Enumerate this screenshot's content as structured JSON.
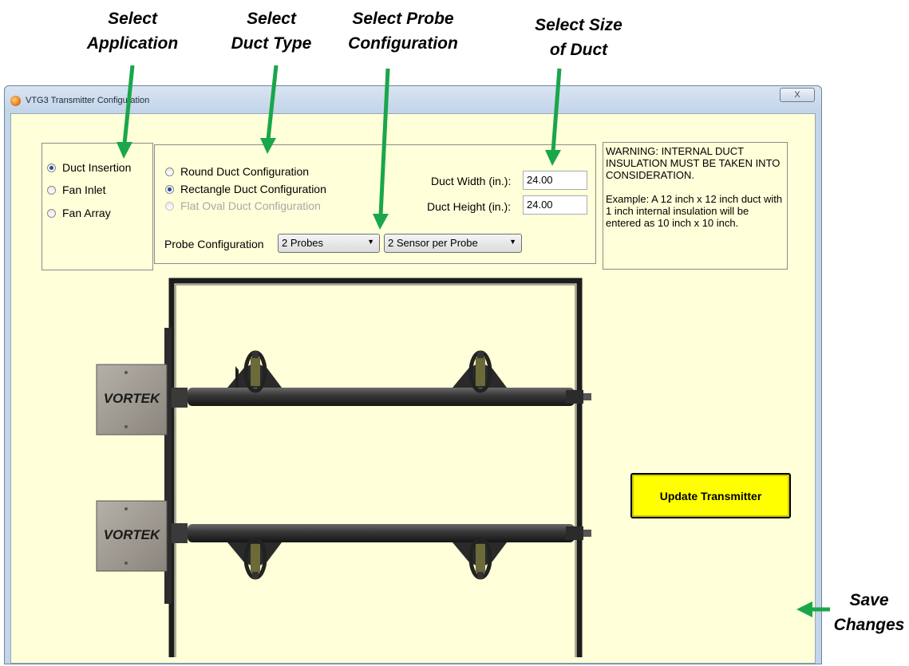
{
  "callouts": {
    "select_application": [
      "Select",
      "Application"
    ],
    "select_duct_type": [
      "Select",
      "Duct Type"
    ],
    "select_probe_configuration": [
      "Select Probe",
      "Configuration"
    ],
    "select_size_of_duct": [
      "Select Size",
      "of Duct"
    ],
    "save_changes": [
      "Save",
      "Changes"
    ]
  },
  "window": {
    "title": "VTG3 Transmitter Configuration",
    "close_label": "X"
  },
  "application": {
    "options": [
      {
        "label": "Duct Insertion",
        "checked": true
      },
      {
        "label": "Fan Inlet",
        "checked": false
      },
      {
        "label": "Fan Array",
        "checked": false
      }
    ]
  },
  "duct_type": {
    "options": [
      {
        "label": "Round Duct Configuration",
        "checked": false,
        "enabled": true
      },
      {
        "label": "Rectangle Duct Configuration",
        "checked": true,
        "enabled": true
      },
      {
        "label": "Flat Oval Duct Configuration",
        "checked": false,
        "enabled": false
      }
    ]
  },
  "duct_size": {
    "width_label": "Duct Width (in.):",
    "width_value": "24.00",
    "height_label": "Duct Height (in.):",
    "height_value": "24.00"
  },
  "probe": {
    "label": "Probe Configuration",
    "probes_selected": "2 Probes",
    "sensors_selected": "2 Sensor per Probe"
  },
  "warning": {
    "line1": "WARNING: INTERNAL DUCT INSULATION MUST BE TAKEN INTO CONSIDERATION.",
    "line2": "Example: A 12 inch x 12 inch duct with 1 inch internal insulation will be entered as 10 inch x 10 inch."
  },
  "diagram": {
    "logo_text": "VORTEK"
  },
  "update_button": "Update Transmitter",
  "colors": {
    "arrow": "#1aa64a",
    "panel_background": "#ffffd9",
    "update_button": "#ffff00"
  }
}
